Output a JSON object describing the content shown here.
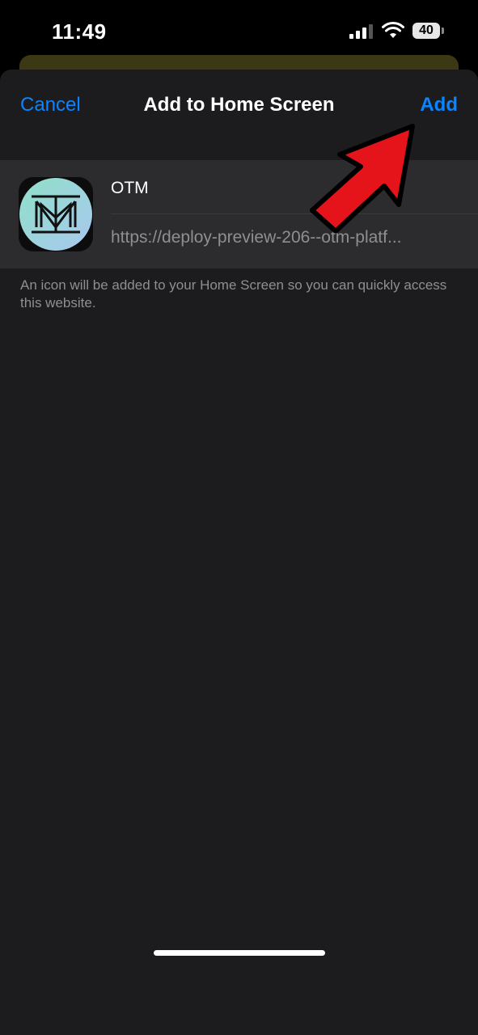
{
  "status_bar": {
    "time": "11:49",
    "battery": "40",
    "icons": [
      "cellular-signal-icon",
      "wifi-icon",
      "battery-icon"
    ]
  },
  "nav": {
    "cancel_label": "Cancel",
    "title": "Add to Home Screen",
    "add_label": "Add"
  },
  "shortcut": {
    "name": "OTM",
    "url": "https://deploy-preview-206--otm-platf...",
    "icon": "otm-logo-icon"
  },
  "note": "An icon will be added to your Home Screen so you can quickly access this website.",
  "colors": {
    "accent": "#0a84ff",
    "sheet": "#1c1c1e",
    "card": "#2c2c2e",
    "secondary_text": "#8e8e93",
    "annotation_arrow": "#e5141b"
  }
}
